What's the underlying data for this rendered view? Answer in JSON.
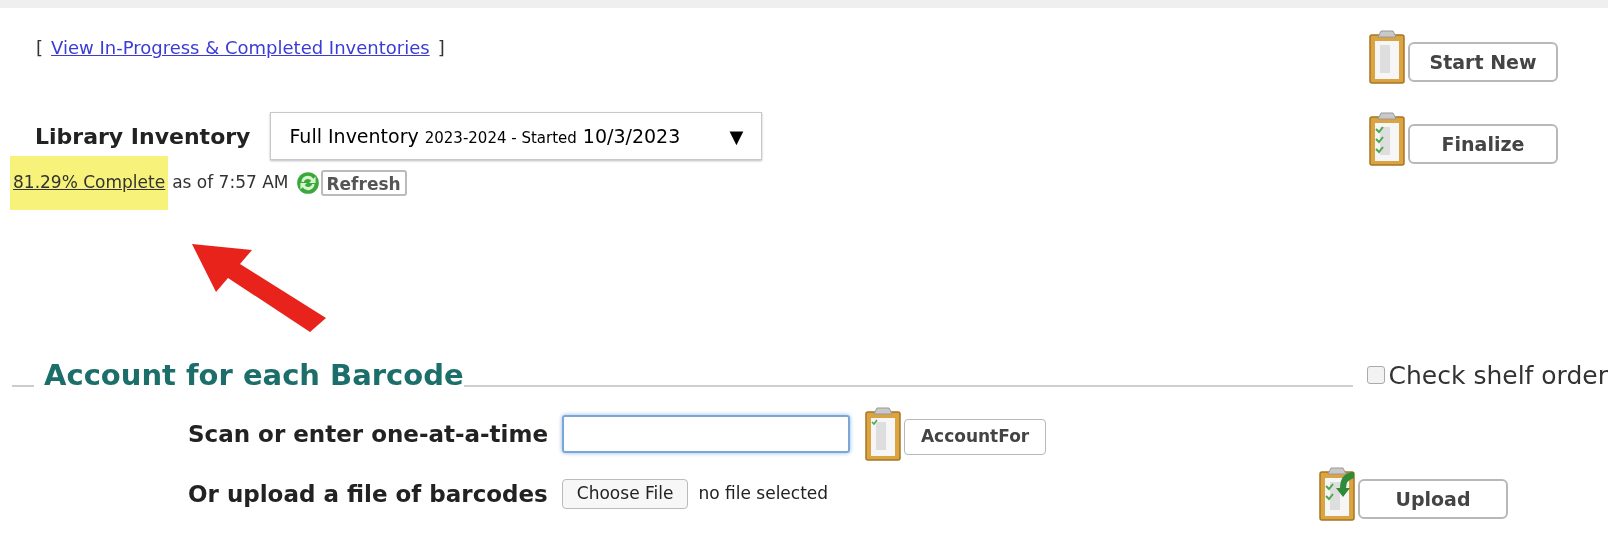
{
  "inventories_link": {
    "open_bracket": "[",
    "label": "View In-Progress & Completed Inventories",
    "close_bracket": "]"
  },
  "start_new_button": {
    "label": "Start New"
  },
  "inventory_selector": {
    "label": "Library Inventory",
    "value_parts": [
      {
        "text": "Full Inventory",
        "kind": "large"
      },
      {
        "text": "2023-2024 - Started",
        "kind": "small"
      },
      {
        "text": "10/3/2023",
        "kind": "large"
      }
    ],
    "caret": "▼"
  },
  "finalize_button": {
    "label": "Finalize"
  },
  "progress": {
    "percent_link": "81.29% Complete",
    "highlighted": true,
    "as_of": "as of 7:57 AM",
    "refresh_label": "Refresh"
  },
  "annotation": {
    "kind": "arrow",
    "color": "#e8231c"
  },
  "barcode_section": {
    "title": "Account for each Barcode",
    "check_shelf_order": {
      "label": "Check shelf order",
      "checked": false
    },
    "scan": {
      "label": "Scan or enter one-at-a-time",
      "focused": true,
      "button": "AccountFor"
    },
    "upload": {
      "label": "Or upload a file of barcodes",
      "choose_button": "Choose File",
      "file_status": "no file selected",
      "button": "Upload"
    }
  }
}
